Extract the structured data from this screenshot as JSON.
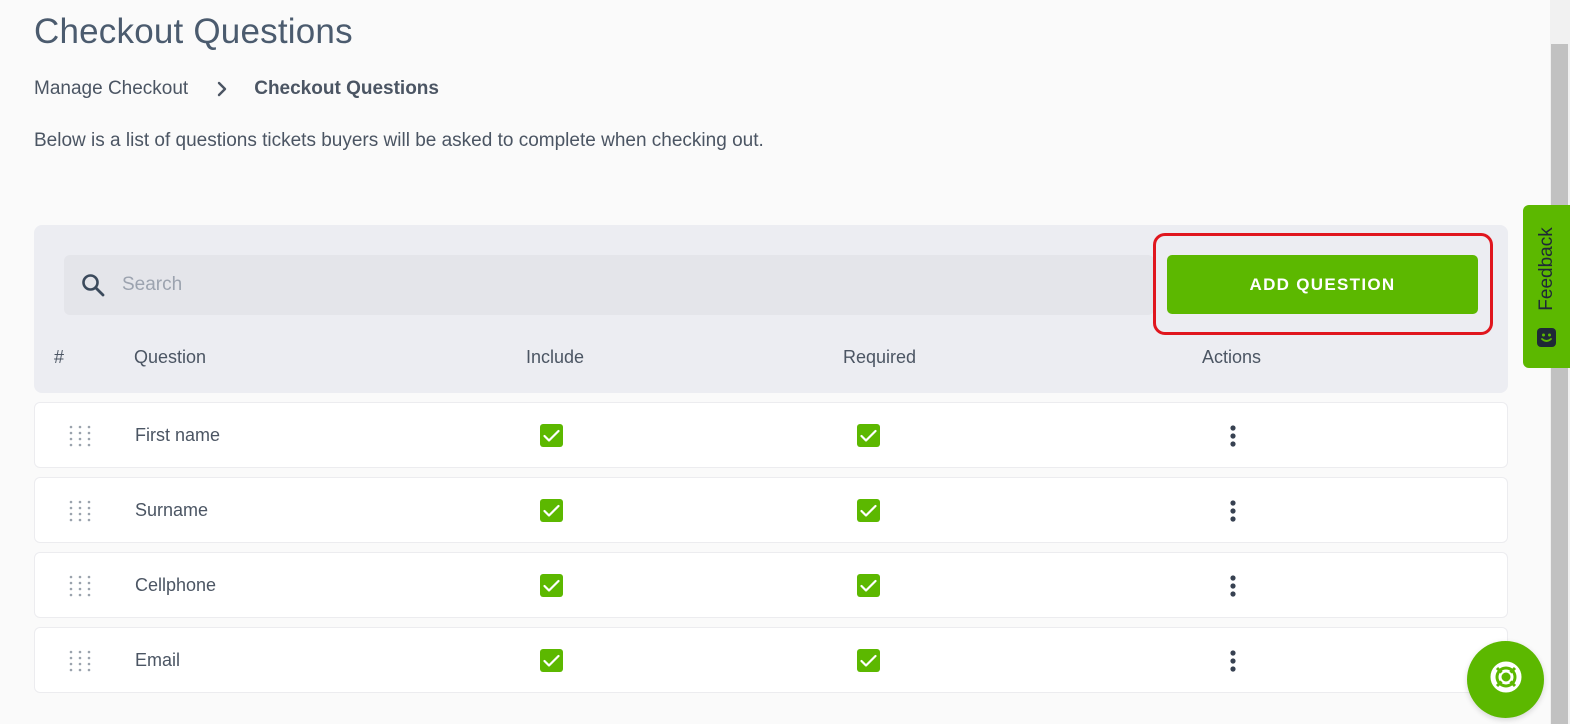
{
  "page": {
    "title": "Checkout Questions",
    "description": "Below is a list of questions tickets buyers will be asked to complete when checking out."
  },
  "breadcrumb": {
    "parent": "Manage Checkout",
    "current": "Checkout Questions"
  },
  "search": {
    "placeholder": "Search",
    "value": ""
  },
  "add_button_label": "ADD QUESTION",
  "table": {
    "columns": [
      "#",
      "Question",
      "Include",
      "Required",
      "Actions"
    ],
    "rows": [
      {
        "question": "First name",
        "include": true,
        "required": true
      },
      {
        "question": "Surname",
        "include": true,
        "required": true
      },
      {
        "question": "Cellphone",
        "include": true,
        "required": true
      },
      {
        "question": "Email",
        "include": true,
        "required": true
      }
    ]
  },
  "feedback": {
    "label": "Feedback"
  },
  "icons": {
    "search": "search-icon",
    "breadcrumb_separator": "chevron-right-icon",
    "drag": "drag-handle-icon",
    "checkbox": "checkbox-checked-icon",
    "actions": "more-vertical-icon",
    "help": "lifebuoy-icon",
    "feedback": "smiley-icon"
  },
  "colors": {
    "brand_green": "#5cb800",
    "highlight_red": "#e0161e",
    "text": "#4b5563",
    "panel_bg": "#ecedf2"
  }
}
